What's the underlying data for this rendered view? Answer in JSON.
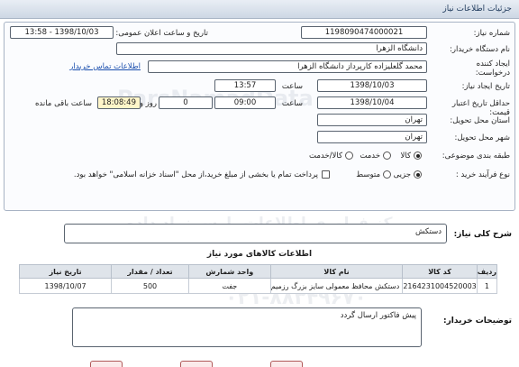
{
  "header": {
    "title": "جزئیات اطلاعات نیاز"
  },
  "form": {
    "need_number_label": "شماره نیاز:",
    "need_number": "1198090474000021",
    "announce_label": "تاریخ و ساعت اعلان عمومی:",
    "announce_value": "1398/10/03 - 13:58",
    "buyer_org_label": "نام دستگاه خریدار:",
    "buyer_org": "دانشگاه الزهرا",
    "creator_label": "ایجاد کننده درخواست:",
    "creator": "محمد گلعلیزاده کارپرداز دانشگاه الزهرا",
    "contact_link": "اطلاعات تماس خریدار",
    "created_date_label": "تاریخ ایجاد نیاز:",
    "created_date": "1398/10/03",
    "time_label": "ساعت",
    "created_time": "13:57",
    "deadline_label": "حداقل تاریخ اعتبار قیمت:",
    "deadline_date": "1398/10/04",
    "deadline_time": "09:00",
    "days": "0",
    "day_and_label": "روز و",
    "remaining_time": "18:08:49",
    "remaining_label": "ساعت باقی مانده",
    "province_label": "استان محل تحویل:",
    "province": "تهران",
    "city_label": "شهر محل تحویل:",
    "city": "تهران",
    "category_label": "طبقه بندی موضوعی:",
    "category_options": [
      "کالا",
      "خدمت",
      "کالا/خدمت"
    ],
    "purchase_type_label": "نوع فرآیند خرید :",
    "purchase_options": [
      "جزیی",
      "متوسط"
    ],
    "payment_note": "پرداخت تمام یا بخشی از مبلغ خرید،از محل \"اسناد خزانه اسلامی\" خواهد بود."
  },
  "summary": {
    "label": "شرح کلی نیاز:",
    "value": "دستکش"
  },
  "items_section_title": "اطلاعات کالاهای مورد نیاز",
  "table": {
    "headers": [
      "ردیف",
      "کد کالا",
      "نام کالا",
      "واحد شمارش",
      "تعداد / مقدار",
      "تاریخ نیاز"
    ],
    "rows": [
      [
        "1",
        "2164231004520003",
        "دستکش محافظ معمولی سایز بزرگ رزمیم",
        "جفت",
        "500",
        "1398/10/07"
      ]
    ]
  },
  "buyer_notes": {
    "label": "توضیحات خریدار:",
    "value": "پیش فاکتور ارسال گردد"
  },
  "watermark": {
    "line1": "ParsNamadData",
    "line2": "مرکز فراوری اطلاعات پارس نماد داده",
    "line3": "۰۲۱-۸۸۳۴۹۶۷۰"
  }
}
